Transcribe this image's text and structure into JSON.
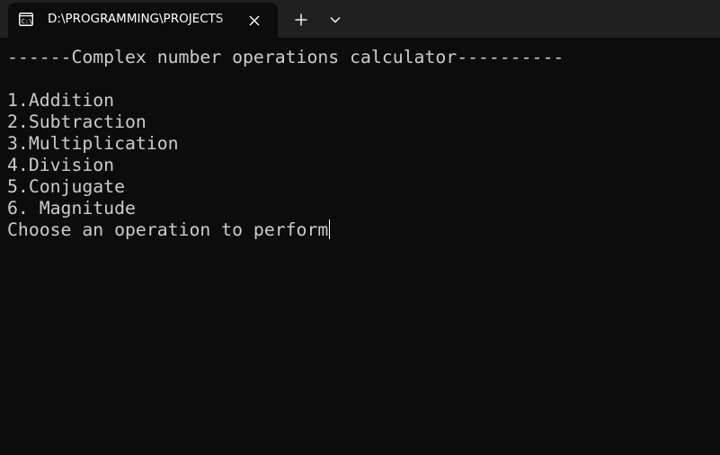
{
  "tab": {
    "title": "D:\\PROGRAMMING\\PROJECTS",
    "icon": "terminal-icon"
  },
  "tabbar": {
    "close_icon": "close-icon",
    "new_tab_icon": "plus-icon",
    "dropdown_icon": "chevron-down-icon"
  },
  "terminal": {
    "header": "------Complex number operations calculator----------",
    "menu": [
      "1.Addition",
      "2.Subtraction",
      "3.Multiplication",
      "4.Division",
      "5.Conjugate",
      "6. Magnitude"
    ],
    "prompt": "Choose an operation to perform"
  },
  "colors": {
    "background": "#0c0c0c",
    "tabbar": "#202020",
    "text": "#cccccc"
  }
}
